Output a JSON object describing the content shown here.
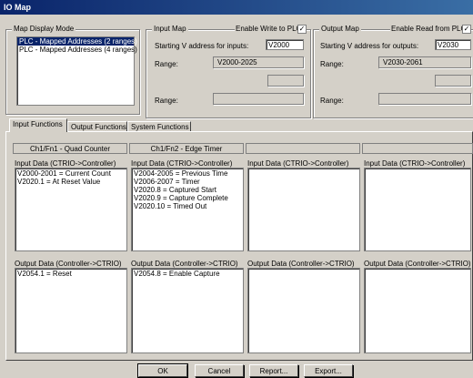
{
  "window": {
    "title": "IO Map"
  },
  "map_display_mode": {
    "title": "Map Display Mode",
    "items": [
      "PLC - Mapped Addresses (2 ranges)",
      "PLC - Mapped Addresses (4 ranges)"
    ]
  },
  "input_map": {
    "title": "Input Map",
    "enable_label": "Enable Write to PLC",
    "enable_checked": true,
    "start_label": "Starting V address for inputs:",
    "start_value": "V2000",
    "range_label": "Range:",
    "range_value": "V2000-2025",
    "range2_label": "Range:"
  },
  "output_map": {
    "title": "Output Map",
    "enable_label": "Enable Read from PLC",
    "enable_checked": true,
    "start_label": "Starting V address for outputs:",
    "start_value": "V2030",
    "range_label": "Range:",
    "range_value": "V2030-2061",
    "range2_label": "Range:"
  },
  "tabs": [
    "Input Functions",
    "Output Functions",
    "System Functions"
  ],
  "columns": [
    {
      "header": "Ch1/Fn1 - Quad Counter",
      "input_label": "Input Data (CTRIO->Controller)",
      "input_lines": [
        "V2000-2001 = Current Count",
        "V2020.1 = At Reset Value"
      ],
      "output_label": "Output Data (Controller->CTRIO)",
      "output_lines": [
        "V2054.1 = Reset"
      ]
    },
    {
      "header": "Ch1/Fn2 - Edge Timer",
      "input_label": "Input Data (CTRIO->Controller)",
      "input_lines": [
        "V2004-2005 = Previous Time",
        "V2006-2007 = Timer",
        "V2020.8 = Captured Start",
        "V2020.9 = Capture Complete",
        "V2020.10 = Timed Out"
      ],
      "output_label": "Output Data (Controller->CTRIO)",
      "output_lines": [
        "V2054.8 = Enable Capture"
      ]
    },
    {
      "header": "",
      "input_label": "Input Data (CTRIO->Controller)",
      "input_lines": [],
      "output_label": "Output Data (Controller->CTRIO)",
      "output_lines": []
    },
    {
      "header": "",
      "input_label": "Input Data (CTRIO->Controller)",
      "input_lines": [],
      "output_label": "Output Data (Controller->CTRIO)",
      "output_lines": []
    }
  ],
  "buttons": {
    "ok": "OK",
    "cancel": "Cancel",
    "report": "Report...",
    "export": "Export..."
  }
}
